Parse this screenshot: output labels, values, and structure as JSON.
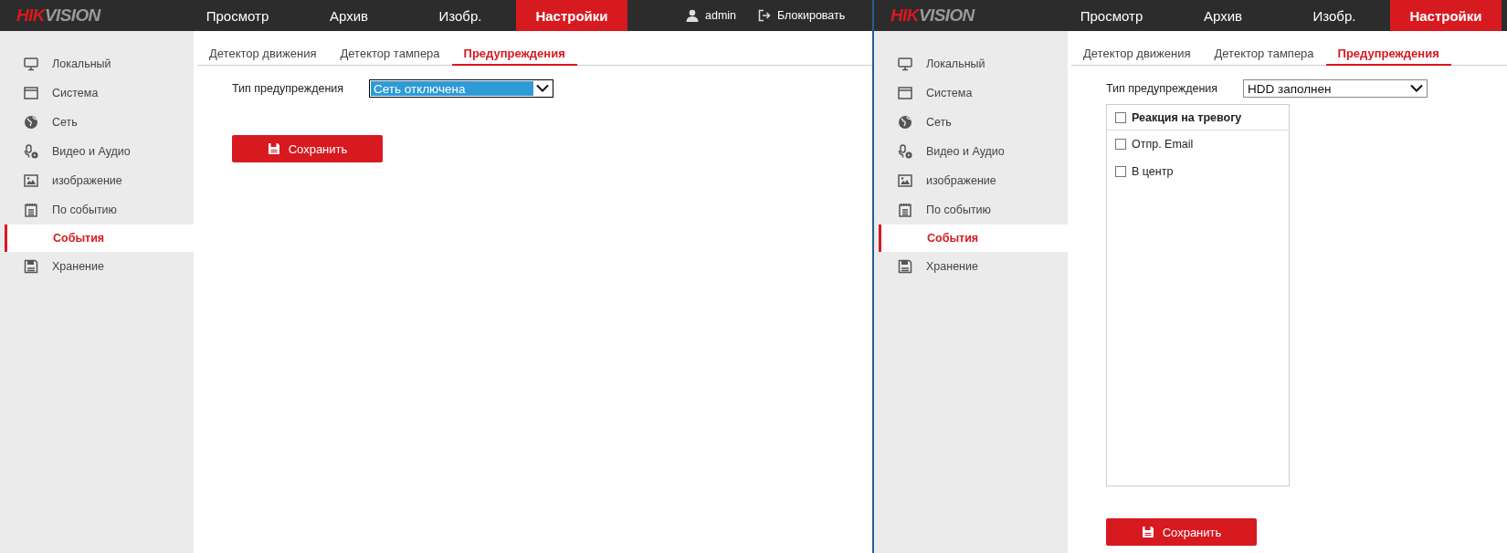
{
  "panels": [
    {
      "header": {
        "logo": {
          "accent": "HIK",
          "rest": "VISION"
        },
        "nav": [
          {
            "label": "Просмотр",
            "selected": false
          },
          {
            "label": "Архив",
            "selected": false
          },
          {
            "label": "Изобр.",
            "selected": false
          },
          {
            "label": "Настройки",
            "selected": true
          }
        ],
        "user": "admin",
        "lock": "Блокировать"
      },
      "sidebar": [
        {
          "label": "Локальный",
          "kind": "monitor",
          "selected": false
        },
        {
          "label": "Система",
          "kind": "window",
          "selected": false
        },
        {
          "label": "Сеть",
          "kind": "globe",
          "selected": false
        },
        {
          "label": "Видео и Аудио",
          "kind": "mic",
          "selected": false
        },
        {
          "label": "изображение",
          "kind": "image",
          "selected": false
        },
        {
          "label": "По событию",
          "kind": "calendar",
          "selected": false,
          "children": [
            {
              "label": "События",
              "selected": true
            }
          ]
        },
        {
          "label": "Хранение",
          "kind": "floppy",
          "selected": false
        }
      ],
      "tabs": [
        {
          "label": "Детектор движения",
          "selected": false
        },
        {
          "label": "Детектор тампера",
          "selected": false
        },
        {
          "label": "Предупреждения",
          "selected": true
        }
      ],
      "alert_type": {
        "label": "Тип предупреждения",
        "value": "Сеть отключена",
        "focused": true
      },
      "save": "Сохранить"
    },
    {
      "header": {
        "logo": {
          "accent": "HIK",
          "rest": "VISION"
        },
        "nav": [
          {
            "label": "Просмотр",
            "selected": false
          },
          {
            "label": "Архив",
            "selected": false
          },
          {
            "label": "Изобр.",
            "selected": false
          },
          {
            "label": "Настройки",
            "selected": true
          }
        ]
      },
      "sidebar": [
        {
          "label": "Локальный",
          "kind": "monitor",
          "selected": false
        },
        {
          "label": "Система",
          "kind": "window",
          "selected": false
        },
        {
          "label": "Сеть",
          "kind": "globe",
          "selected": false
        },
        {
          "label": "Видео и Аудио",
          "kind": "mic",
          "selected": false
        },
        {
          "label": "изображение",
          "kind": "image",
          "selected": false
        },
        {
          "label": "По событию",
          "kind": "calendar",
          "selected": false,
          "children": [
            {
              "label": "События",
              "selected": true
            }
          ]
        },
        {
          "label": "Хранение",
          "kind": "floppy",
          "selected": false
        }
      ],
      "tabs": [
        {
          "label": "Детектор движения",
          "selected": false
        },
        {
          "label": "Детектор тампера",
          "selected": false
        },
        {
          "label": "Предупреждения",
          "selected": true
        }
      ],
      "alert_type": {
        "label": "Тип предупреждения",
        "value": "HDD заполнен",
        "focused": false
      },
      "actions": {
        "header": {
          "label": "Реакция на тревогу",
          "checked": false
        },
        "items": [
          {
            "label": "Отпр. Email",
            "checked": false
          },
          {
            "label": "В центр",
            "checked": false
          }
        ]
      },
      "save": "Сохранить"
    }
  ]
}
